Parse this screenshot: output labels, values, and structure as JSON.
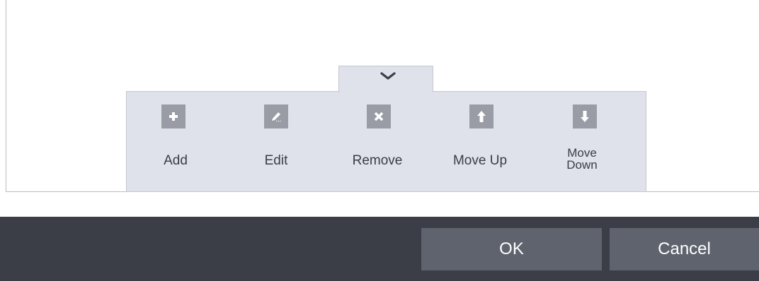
{
  "toolbar": {
    "tools": [
      {
        "label": "Add",
        "icon": "plus-icon"
      },
      {
        "label": "Edit",
        "icon": "pencil-icon"
      },
      {
        "label": "Remove",
        "icon": "x-icon"
      },
      {
        "label": "Move Up",
        "icon": "arrow-up-icon"
      },
      {
        "label": "Move Down",
        "label_line1": "Move",
        "label_line2": "Down",
        "icon": "arrow-down-icon"
      }
    ],
    "collapse_icon": "chevron-down-icon"
  },
  "footer": {
    "ok_label": "OK",
    "cancel_label": "Cancel"
  },
  "colors": {
    "panel_bg": "#dfe2ea",
    "tile_bg": "#9a9ca5",
    "footer_bg": "#3b3e46",
    "button_bg": "#5f636e"
  }
}
